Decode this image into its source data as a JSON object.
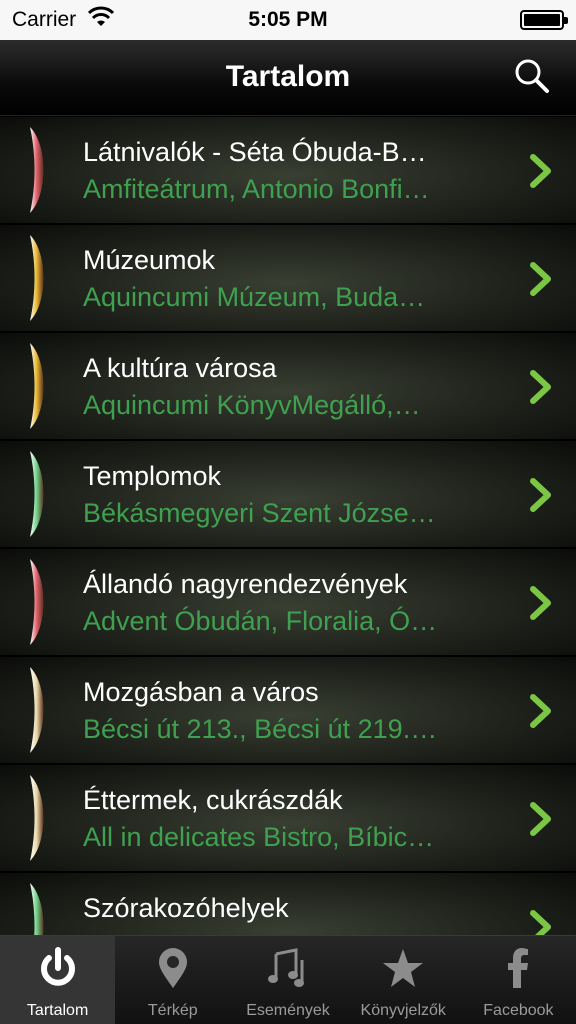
{
  "status_bar": {
    "carrier": "Carrier",
    "time": "5:05 PM"
  },
  "nav": {
    "title": "Tartalom",
    "search_icon": "search-icon"
  },
  "colors": {
    "subtitle_green": "#3fa04f",
    "chevron_green": "#7cc646",
    "leaf_red": "#e0606a",
    "leaf_yellow": "#e8b830",
    "leaf_green": "#6fd28a",
    "leaf_cream": "#e8d8a8"
  },
  "rows": [
    {
      "title": "Látnivalók - Séta Óbuda-B…",
      "subtitle": "Amfiteátrum, Antonio Bonfi…",
      "leaf": "red"
    },
    {
      "title": "Múzeumok",
      "subtitle": "Aquincumi Múzeum, Buda…",
      "leaf": "yellow"
    },
    {
      "title": "A kultúra városa",
      "subtitle": "Aquincumi KönyvMegálló,…",
      "leaf": "yellow"
    },
    {
      "title": "Templomok",
      "subtitle": "Békásmegyeri Szent Józse…",
      "leaf": "green"
    },
    {
      "title": "Állandó nagyrendezvények",
      "subtitle": "Advent Óbudán, Floralia, Ó…",
      "leaf": "red"
    },
    {
      "title": "Mozgásban a város",
      "subtitle": "Bécsi út 213., Bécsi út 219.…",
      "leaf": "cream"
    },
    {
      "title": "Éttermek, cukrászdák",
      "subtitle": "All in delicates Bistro, Bíbic…",
      "leaf": "cream"
    },
    {
      "title": "Szórakozóhelyek",
      "subtitle": "",
      "leaf": "green"
    }
  ],
  "tabs": [
    {
      "label": "Tartalom",
      "icon": "power-icon",
      "active": true
    },
    {
      "label": "Térkép",
      "icon": "map-pin-icon",
      "active": false
    },
    {
      "label": "Események",
      "icon": "music-note-icon",
      "active": false
    },
    {
      "label": "Könyvjelzők",
      "icon": "star-icon",
      "active": false
    },
    {
      "label": "Facebook",
      "icon": "facebook-icon",
      "active": false
    }
  ]
}
